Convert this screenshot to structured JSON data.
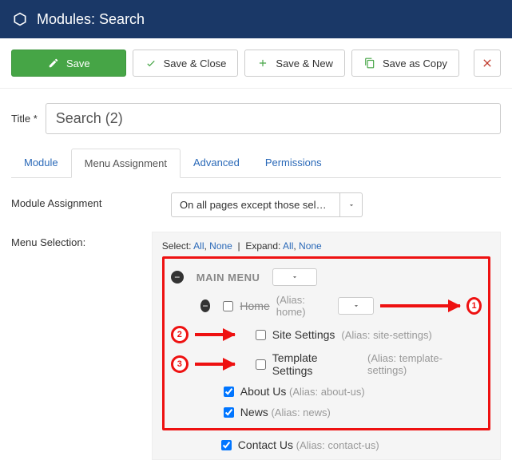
{
  "header": {
    "title": "Modules: Search"
  },
  "toolbar": {
    "save": "Save",
    "save_close": "Save & Close",
    "save_new": "Save & New",
    "save_copy": "Save as Copy"
  },
  "title_field": {
    "label": "Title *",
    "value": "Search (2)"
  },
  "tabs": [
    {
      "id": "module",
      "label": "Module"
    },
    {
      "id": "menuassign",
      "label": "Menu Assignment"
    },
    {
      "id": "advanced",
      "label": "Advanced"
    },
    {
      "id": "permissions",
      "label": "Permissions"
    }
  ],
  "assignment": {
    "label": "Module Assignment",
    "value": "On all pages except those selec.."
  },
  "selection": {
    "label": "Menu Selection:",
    "select_label": "Select:",
    "expand_label": "Expand:",
    "all": "All",
    "none": "None",
    "menu_label": "MAIN MENU",
    "items": [
      {
        "label": "Home",
        "alias": "(Alias: home)",
        "checked": false,
        "strike": true
      },
      {
        "label": "Site Settings",
        "alias": "(Alias: site-settings)",
        "checked": false
      },
      {
        "label": "Template Settings",
        "alias": "(Alias: template-settings)",
        "checked": false
      },
      {
        "label": "About Us",
        "alias": "(Alias: about-us)",
        "checked": true
      },
      {
        "label": "News",
        "alias": "(Alias: news)",
        "checked": true
      },
      {
        "label": "Contact Us",
        "alias": "(Alias: contact-us)",
        "checked": true
      }
    ]
  },
  "markers": {
    "m1": "1",
    "m2": "2",
    "m3": "3"
  }
}
